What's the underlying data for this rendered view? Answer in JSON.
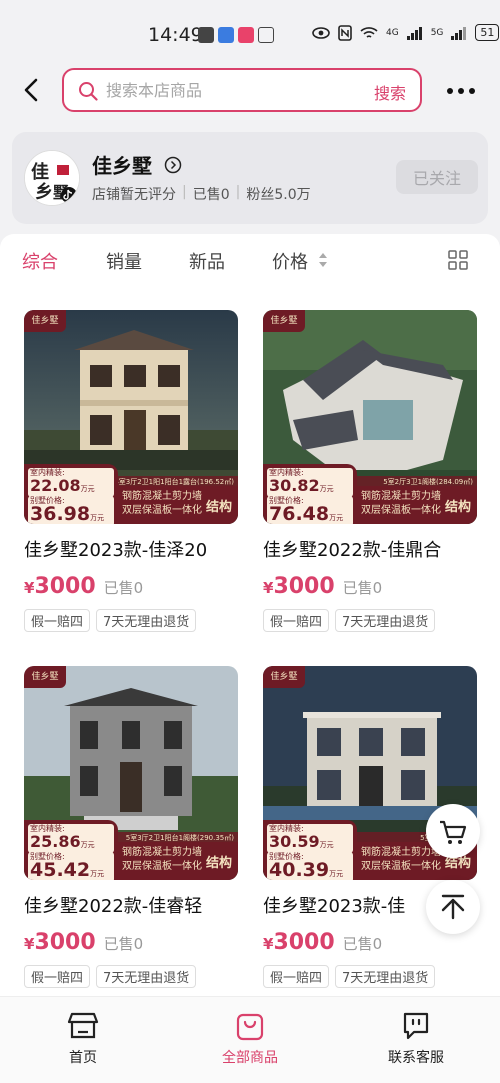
{
  "status": {
    "time": "14:49",
    "network_1": "4G",
    "network_2": "5G",
    "battery": "51"
  },
  "header": {
    "search_placeholder": "搜索本店商品",
    "search_button": "搜索"
  },
  "shop": {
    "name": "佳乡墅",
    "logo_text": "佳乡墅",
    "rating": "店铺暂无评分",
    "sold": "已售0",
    "fans": "粉丝5.0万",
    "follow_button": "已关注"
  },
  "tabs": [
    {
      "label": "综合",
      "active": true
    },
    {
      "label": "销量",
      "active": false
    },
    {
      "label": "新品",
      "active": false
    },
    {
      "label": "价格",
      "active": false
    }
  ],
  "products": [
    {
      "title": "佳乡墅2023款-佳泽20",
      "currency": "¥",
      "price": "3000",
      "sold": "已售0",
      "badges": [
        "假一赔四",
        "7天无理由退货"
      ],
      "image_tag": "佳乡墅",
      "interior_label": "室内精装:",
      "interior_price": "22.08",
      "villa_label": "别墅价格:",
      "villa_price": "36.98",
      "unit": "万元",
      "spec": "4室3厅2卫1阳1阳台1露台(196.52㎡)",
      "feature_1": "钢筋混凝土剪力墙",
      "feature_2": "双层保温板一体化",
      "struct": "结构"
    },
    {
      "title": "佳乡墅2022款-佳鼎合",
      "currency": "¥",
      "price": "3000",
      "sold": "已售0",
      "badges": [
        "假一赔四",
        "7天无理由退货"
      ],
      "image_tag": "佳乡墅",
      "interior_label": "室内精装:",
      "interior_price": "30.82",
      "villa_label": "别墅价格:",
      "villa_price": "76.48",
      "unit": "万元",
      "spec": "5室2厅3卫1阁楼(284.09㎡)",
      "feature_1": "钢筋混凝土剪力墙",
      "feature_2": "双层保温板一体化",
      "struct": "结构"
    },
    {
      "title": "佳乡墅2022款-佳睿轻",
      "currency": "¥",
      "price": "3000",
      "sold": "已售0",
      "badges": [
        "假一赔四",
        "7天无理由退货"
      ],
      "image_tag": "佳乡墅",
      "interior_label": "室内精装:",
      "interior_price": "25.86",
      "villa_label": "别墅价格:",
      "villa_price": "45.42",
      "unit": "万元",
      "spec": "5室3厅2卫1阳台1阁楼(290.35㎡)",
      "feature_1": "钢筋混凝土剪力墙",
      "feature_2": "双层保温板一体化",
      "struct": "结构"
    },
    {
      "title": "佳乡墅2023款-佳",
      "currency": "¥",
      "price": "3000",
      "sold": "已售0",
      "badges": [
        "假一赔四",
        "7天无理由退货"
      ],
      "image_tag": "佳乡墅",
      "interior_label": "室内精装:",
      "interior_price": "30.59",
      "villa_label": "别墅价格:",
      "villa_price": "40.39",
      "unit": "万元",
      "spec": "5室3厅3卫2露台",
      "feature_1": "钢筋混凝土剪力墙",
      "feature_2": "双层保温板一体化",
      "struct": "结构"
    }
  ],
  "bottom_nav": [
    {
      "label": "首页",
      "active": false
    },
    {
      "label": "全部商品",
      "active": true
    },
    {
      "label": "联系客服",
      "active": false
    }
  ],
  "colors": {
    "accent": "#d9416b",
    "badge_dark": "#6e1b25",
    "badge_light": "#fbeee0"
  }
}
